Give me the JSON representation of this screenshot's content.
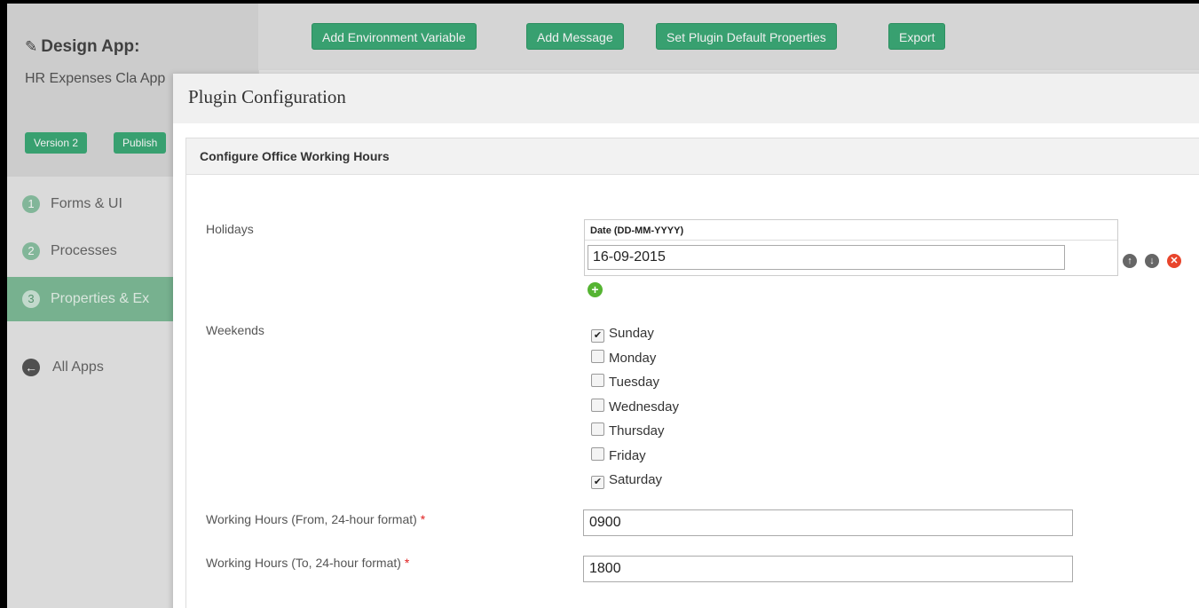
{
  "sidebar": {
    "app_title": "Design App:",
    "app_name": "HR Expenses Cla App",
    "version_label": "Version 2",
    "publish_label": "Publish",
    "nav": [
      {
        "num": "1",
        "label": "Forms & UI"
      },
      {
        "num": "2",
        "label": "Processes"
      },
      {
        "num": "3",
        "label": "Properties & Ex"
      }
    ],
    "all_apps_label": "All Apps"
  },
  "toolbar": {
    "add_env_var": "Add Environment Variable",
    "add_message": "Add Message",
    "set_plugin_defaults": "Set Plugin Default Properties",
    "export": "Export"
  },
  "modal": {
    "title": "Plugin Configuration",
    "section_title": "Configure Office Working Hours",
    "holidays": {
      "label": "Holidays",
      "column_header": "Date (DD-MM-YYYY)",
      "rows": [
        "16-09-2015"
      ]
    },
    "weekends": {
      "label": "Weekends",
      "days": [
        {
          "label": "Sunday",
          "checked": true
        },
        {
          "label": "Monday",
          "checked": false
        },
        {
          "label": "Tuesday",
          "checked": false
        },
        {
          "label": "Wednesday",
          "checked": false
        },
        {
          "label": "Thursday",
          "checked": false
        },
        {
          "label": "Friday",
          "checked": false
        },
        {
          "label": "Saturday",
          "checked": true
        }
      ]
    },
    "hours_from": {
      "label": "Working Hours (From, 24-hour format)",
      "required": "*",
      "value": "0900"
    },
    "hours_to": {
      "label": "Working Hours (To, 24-hour format)",
      "required": "*",
      "value": "1800"
    }
  },
  "colors": {
    "accent": "#3cab78",
    "active_nav": "#7fbd98",
    "delete": "#e8452c"
  }
}
